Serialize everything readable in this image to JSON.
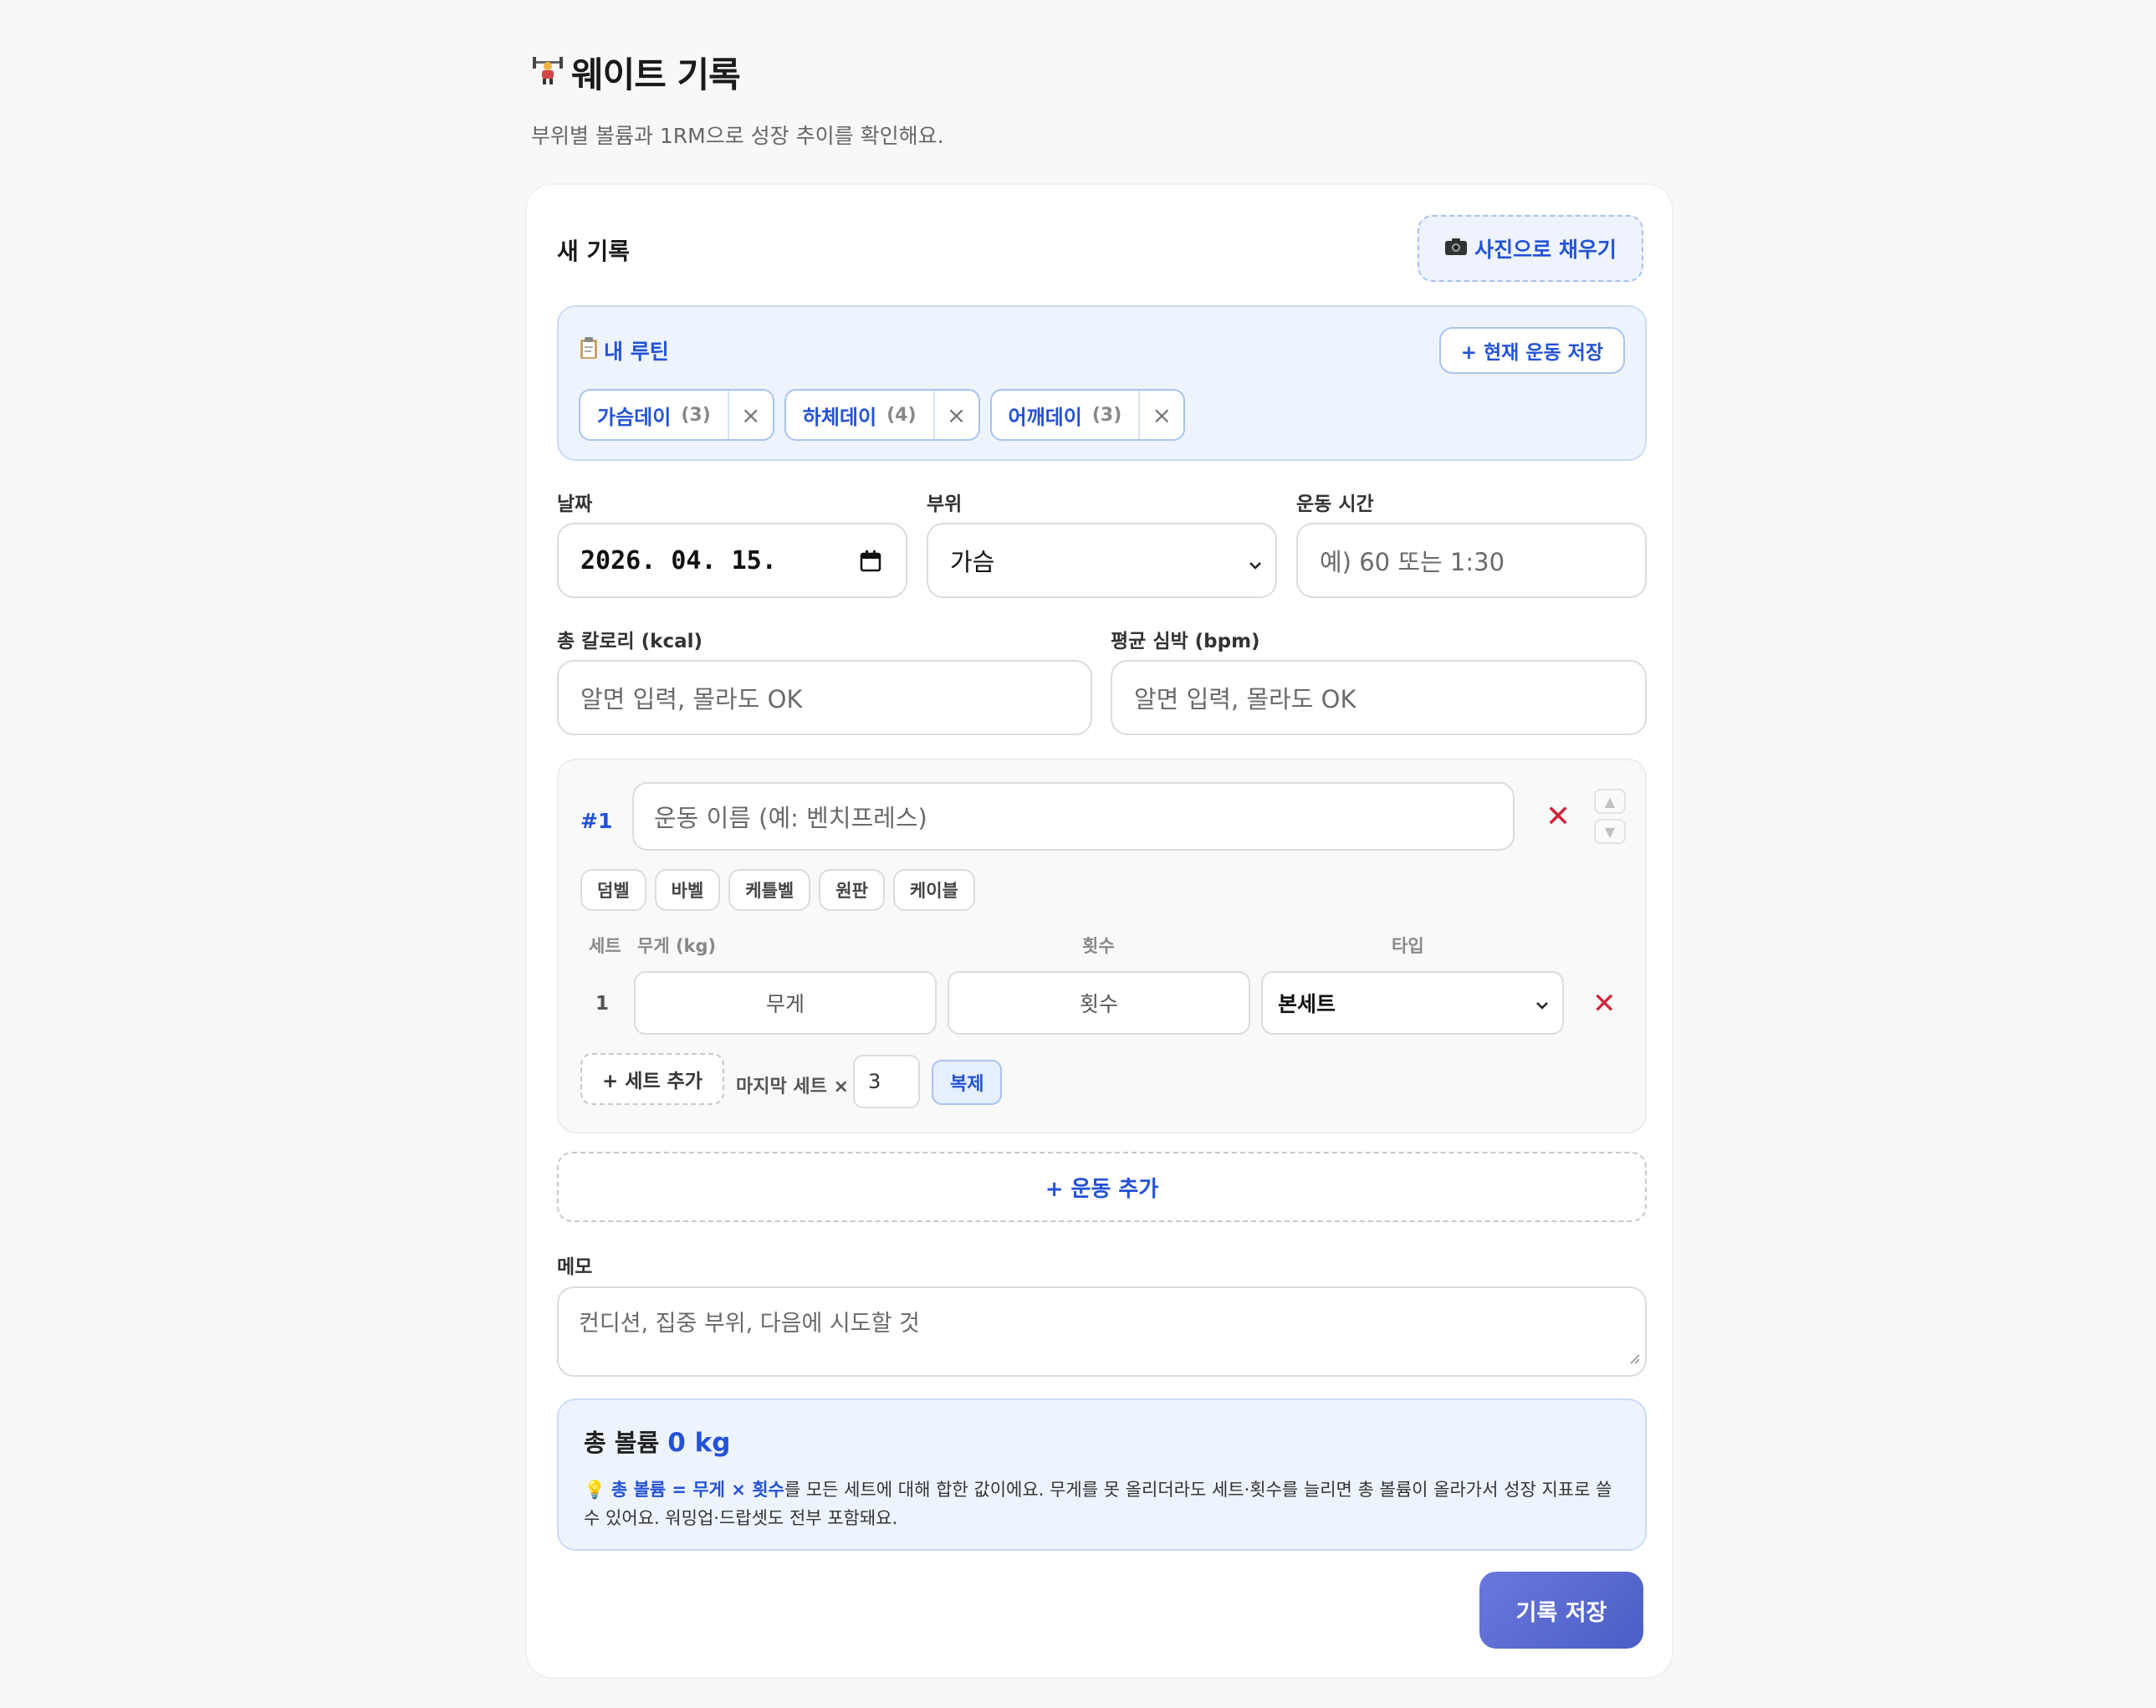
{
  "header": {
    "title": "웨이트 기록",
    "subtitle": "부위별 볼륨과 1RM으로 성장 추이를 확인해요."
  },
  "form": {
    "title": "새 기록",
    "photo_button": "사진으로 채우기"
  },
  "routine": {
    "title": "내 루틴",
    "save_button": "+ 현재 운동 저장",
    "items": [
      {
        "label": "가슴데이",
        "count": "(3)"
      },
      {
        "label": "하체데이",
        "count": "(4)"
      },
      {
        "label": "어깨데이",
        "count": "(3)"
      }
    ]
  },
  "fields": {
    "date_label": "날짜",
    "date_value": "2026. 04. 15.",
    "part_label": "부위",
    "part_value": "가슴",
    "duration_label": "운동 시간",
    "duration_placeholder": "예) 60 또는 1:30",
    "calorie_label": "총 칼로리 (kcal)",
    "calorie_placeholder": "알면 입력, 몰라도 OK",
    "hr_label": "평균 심박 (bpm)",
    "hr_placeholder": "알면 입력, 몰라도 OK"
  },
  "exercise": {
    "number": "#1",
    "name_placeholder": "운동 이름 (예: 벤치프레스)",
    "equipment": [
      "덤벨",
      "바벨",
      "케틀벨",
      "원판",
      "케이블"
    ],
    "columns": {
      "set": "세트",
      "weight": "무게 (kg)",
      "reps": "횟수",
      "type": "타입"
    },
    "sets": [
      {
        "index": "1",
        "weight_placeholder": "무게",
        "reps_placeholder": "횟수",
        "type": "본세트"
      }
    ],
    "add_set": "+ 세트 추가",
    "last_set_label": "마지막 세트 ×",
    "repeat_value": "3",
    "duplicate": "복제"
  },
  "add_exercise": "+ 운동 추가",
  "memo": {
    "label": "메모",
    "placeholder": "컨디션, 집중 부위, 다음에 시도할 것"
  },
  "volume": {
    "label": "총 볼륨",
    "value": "0 kg",
    "note_highlight": "총 볼륨 = 무게 × 횟수",
    "note_rest": "를 모든 세트에 대해 합한 값이에요. 무게를 못 올리더라도 세트·횟수를 늘리면 총 볼륨이 올라가서 성장 지표로 쓸 수 있어요. 워밍업·드랍셋도 전부 포함돼요."
  },
  "submit": "기록 저장",
  "colors": {
    "accent": "#2352d8",
    "danger": "#d0253c",
    "submit": "#5567d2"
  }
}
